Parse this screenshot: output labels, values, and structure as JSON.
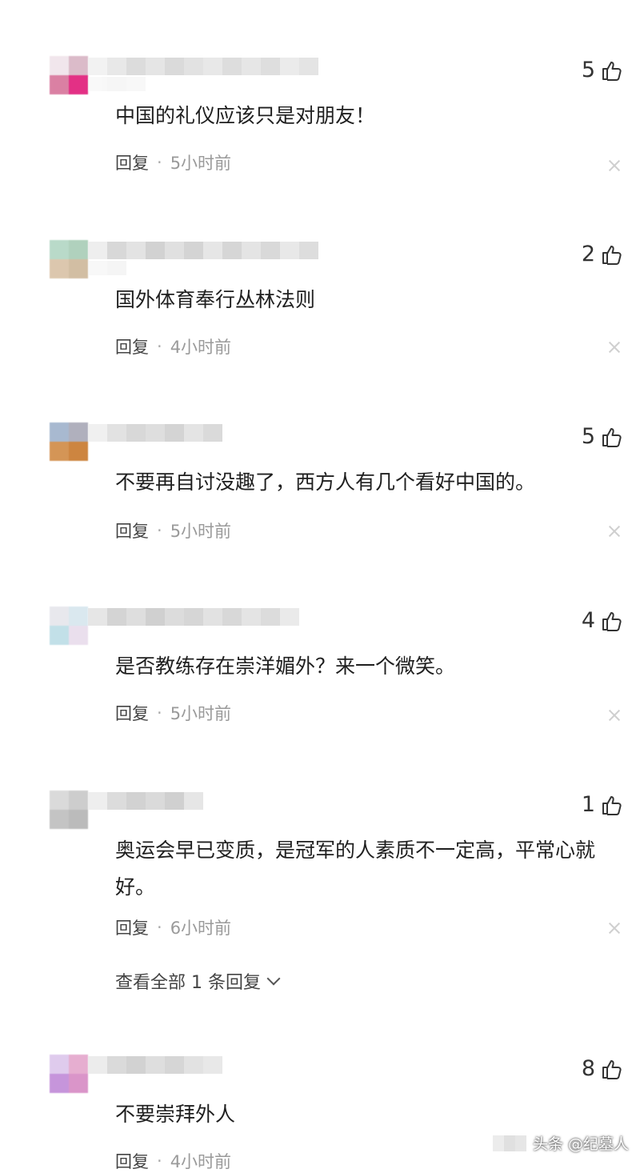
{
  "comments": [
    {
      "likes": "5",
      "text": "中国的礼仪应该只是对朋友！",
      "reply_label": "回复",
      "separator": "·",
      "time": "5小时前"
    },
    {
      "likes": "2",
      "text": "国外体育奉行丛林法则",
      "reply_label": "回复",
      "separator": "·",
      "time": "4小时前"
    },
    {
      "likes": "5",
      "text": "不要再自讨没趣了，西方人有几个看好中国的。",
      "reply_label": "回复",
      "separator": "·",
      "time": "5小时前"
    },
    {
      "likes": "4",
      "text": "是否教练存在崇洋媚外？来一个微笑。",
      "reply_label": "回复",
      "separator": "·",
      "time": "5小时前"
    },
    {
      "likes": "1",
      "text": "奥运会早已变质，是冠军的人素质不一定高，平常心就好。",
      "reply_label": "回复",
      "separator": "·",
      "time": "6小时前",
      "view_replies": "查看全部 1 条回复"
    },
    {
      "likes": "8",
      "text": "不要崇拜外人",
      "reply_label": "回复",
      "separator": "·",
      "time": "4小时前"
    }
  ],
  "watermark": {
    "text": "头条 @纪墓人"
  },
  "colors": {
    "text": "#1f1f1f",
    "meta": "#9a9a9a",
    "icon": "#333333"
  },
  "icons": {
    "like": "thumbs-up-icon",
    "close": "close-icon",
    "expand": "chevron-down-icon"
  }
}
